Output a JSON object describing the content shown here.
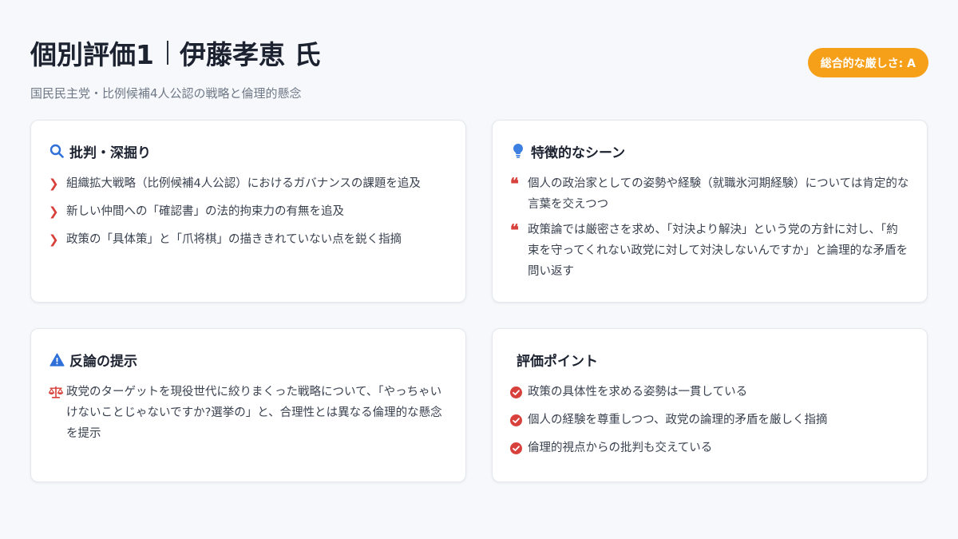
{
  "header": {
    "title_main": "個別評価1",
    "title_name": "伊藤孝恵 氏",
    "subtitle": "国民民主党・比例候補4人公認の戦略と倫理的懸念"
  },
  "badge": {
    "label": "総合的な厳しさ: A",
    "color": "#f6a01a"
  },
  "cards": {
    "critique": {
      "icon": "search-icon",
      "title": "批判・深掘り",
      "items": [
        "組織拡大戦略（比例候補4人公認）におけるガバナンスの課題を追及",
        "新しい仲間への「確認書」の法的拘束力の有無を追及",
        "政策の「具体策」と「爪将棋」の描ききれていない点を鋭く指摘"
      ]
    },
    "scenes": {
      "icon": "lightbulb-icon",
      "title": "特徴的なシーン",
      "items": [
        "個人の政治家としての姿勢や経験（就職氷河期経験）については肯定的な言葉を交えつつ",
        "政策論では厳密さを求め、「対決より解決」という党の方針に対し、「約束を守ってくれない政党に対して対決しないんですか」と論理的な矛盾を問い返す"
      ]
    },
    "counter": {
      "icon": "warning-icon",
      "title": "反論の提示",
      "items": [
        "政党のターゲットを現役世代に絞りまくった戦略について、「やっちゃいけないことじゃないですか?選挙の」と、合理性とは異なる倫理的な懸念を提示"
      ]
    },
    "points": {
      "title": "評価ポイント",
      "items": [
        "政策の具体性を求める姿勢は一貫している",
        "個人の経験を尊重しつつ、政党の論理的矛盾を厳しく指摘",
        "倫理的視点からの批判も交えている"
      ]
    }
  },
  "colors": {
    "accent_red": "#d8413b",
    "icon_blue": "#2f6fd8",
    "text": "#1c2230"
  }
}
